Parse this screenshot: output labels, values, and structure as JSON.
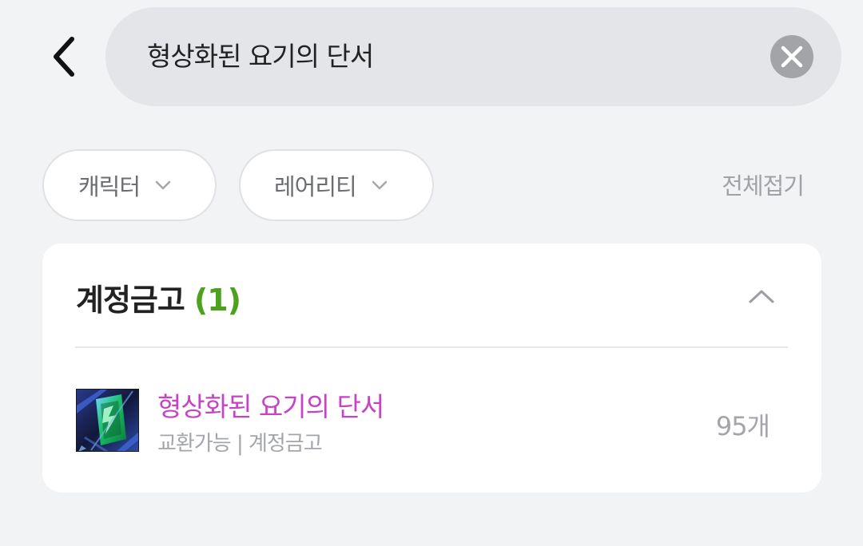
{
  "search": {
    "value": "형상화된 요기의 단서"
  },
  "icons": {
    "back": "back-arrow-icon",
    "clear": "close-icon",
    "chip_chevron": "chevron-down-icon",
    "section_toggle": "chevron-up-icon"
  },
  "filters": {
    "character_label": "캐릭터",
    "rarity_label": "레어리티",
    "collapse_all_label": "전체접기"
  },
  "section": {
    "title": "계정금고",
    "count": "(1)",
    "items": [
      {
        "name": "형상화된 요기의 단서",
        "meta": "교환가능 | 계정금고",
        "quantity": "95개"
      }
    ]
  },
  "colors": {
    "item_name": "#c742c7",
    "count": "#4ca21f",
    "background": "#f2f3f5"
  }
}
